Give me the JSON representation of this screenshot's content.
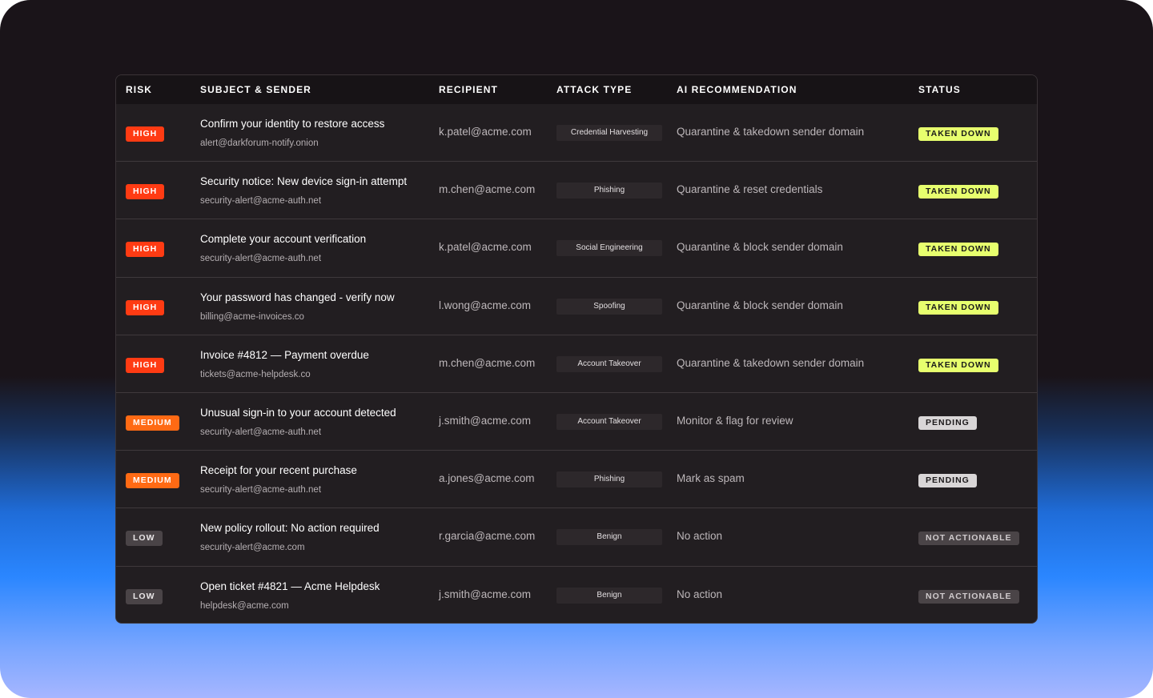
{
  "colors": {
    "high": "#ff3b13",
    "medium": "#ff6a14",
    "low": "#4a4447",
    "taken_down": "#e7ff6e",
    "pending": "#d9d6d7",
    "not_actionable": "#4a4447"
  },
  "table": {
    "headers": {
      "risk": "RISK",
      "subject_sender": "SUBJECT & SENDER",
      "recipient": "RECIPIENT",
      "attack_type": "ATTACK TYPE",
      "ai_recommendation": "AI RECOMMENDATION",
      "status": "STATUS"
    },
    "rows": [
      {
        "risk": "HIGH",
        "subject": "Confirm your identity to restore access",
        "sender": "alert@darkforum-notify.onion",
        "recipient": "k.patel@acme.com",
        "attack_type": "Credential Harvesting",
        "recommendation": "Quarantine & takedown sender domain",
        "status": "TAKEN DOWN"
      },
      {
        "risk": "HIGH",
        "subject": "Security notice: New device sign-in attempt",
        "sender": "security-alert@acme-auth.net",
        "recipient": "m.chen@acme.com",
        "attack_type": "Phishing",
        "recommendation": "Quarantine & reset credentials",
        "status": "TAKEN DOWN"
      },
      {
        "risk": "HIGH",
        "subject": "Complete your account verification",
        "sender": "security-alert@acme-auth.net",
        "recipient": "k.patel@acme.com",
        "attack_type": "Social Engineering",
        "recommendation": "Quarantine & block sender domain",
        "status": "TAKEN DOWN"
      },
      {
        "risk": "HIGH",
        "subject": "Your password has changed - verify now",
        "sender": "billing@acme-invoices.co",
        "recipient": "l.wong@acme.com",
        "attack_type": "Spoofing",
        "recommendation": "Quarantine & block sender domain",
        "status": "TAKEN DOWN"
      },
      {
        "risk": "HIGH",
        "subject": "Invoice #4812 — Payment overdue",
        "sender": "tickets@acme-helpdesk.co",
        "recipient": "m.chen@acme.com",
        "attack_type": "Account Takeover",
        "recommendation": "Quarantine & takedown sender domain",
        "status": "TAKEN DOWN"
      },
      {
        "risk": "MEDIUM",
        "subject": "Unusual sign-in to your account detected",
        "sender": "security-alert@acme-auth.net",
        "recipient": "j.smith@acme.com",
        "attack_type": "Account Takeover",
        "recommendation": "Monitor & flag for review",
        "status": "PENDING"
      },
      {
        "risk": "MEDIUM",
        "subject": "Receipt for your recent purchase",
        "sender": "security-alert@acme-auth.net",
        "recipient": "a.jones@acme.com",
        "attack_type": "Phishing",
        "recommendation": "Mark as spam",
        "status": "PENDING"
      },
      {
        "risk": "LOW",
        "subject": "New policy rollout: No action required",
        "sender": "security-alert@acme.com",
        "recipient": "r.garcia@acme.com",
        "attack_type": "Benign",
        "recommendation": "No action",
        "status": "NOT ACTIONABLE"
      },
      {
        "risk": "LOW",
        "subject": "Open ticket #4821 — Acme Helpdesk",
        "sender": "helpdesk@acme.com",
        "recipient": "j.smith@acme.com",
        "attack_type": "Benign",
        "recommendation": "No action",
        "status": "NOT ACTIONABLE"
      }
    ]
  }
}
